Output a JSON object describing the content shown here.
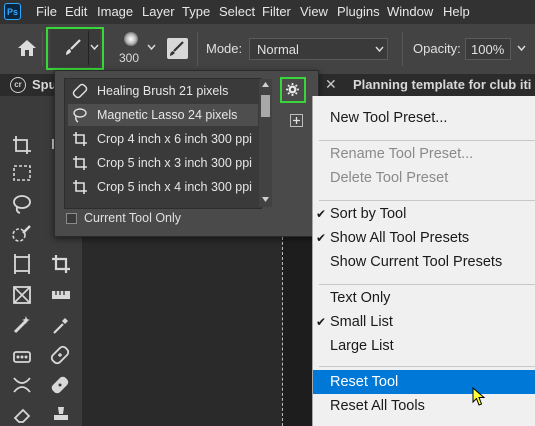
{
  "menubar": {
    "logo": "Ps",
    "items": [
      "File",
      "Edit",
      "Image",
      "Layer",
      "Type",
      "Select",
      "Filter",
      "View",
      "Plugins",
      "Window",
      "Help"
    ]
  },
  "options": {
    "brush_size": "300",
    "mode_label": "Mode:",
    "mode_value": "Normal",
    "opacity_label": "Opacity:",
    "opacity_value": "100%"
  },
  "tabs": {
    "left_tab_partial": "Spu",
    "doc_tab": "Planning template for club iti"
  },
  "preset_picker": {
    "presets": [
      {
        "icon": "healing-brush-icon",
        "label": "Healing Brush 21 pixels"
      },
      {
        "icon": "magnetic-lasso-icon",
        "label": "Magnetic Lasso 24 pixels"
      },
      {
        "icon": "crop-icon",
        "label": "Crop 4 inch x 6 inch 300 ppi"
      },
      {
        "icon": "crop-icon",
        "label": "Crop 5 inch x 3 inch 300 ppi"
      },
      {
        "icon": "crop-icon",
        "label": "Crop 5 inch x 4 inch 300 ppi"
      }
    ],
    "current_tool_only_label": "Current Tool Only",
    "current_tool_only_checked": false
  },
  "context_menu": {
    "new_tool_preset": "New Tool Preset...",
    "rename_tool_preset": "Rename Tool Preset...",
    "delete_tool_preset": "Delete Tool Preset",
    "sort_by_tool": "Sort by Tool",
    "show_all_tool_presets": "Show All Tool Presets",
    "show_current_tool_presets": "Show Current Tool Presets",
    "text_only": "Text Only",
    "small_list": "Small List",
    "large_list": "Large List",
    "reset_tool": "Reset Tool",
    "reset_all_tools": "Reset All Tools"
  },
  "colors": {
    "highlight": "#0078d7",
    "annotation": "#39d639",
    "cursor": "#ffff33"
  }
}
